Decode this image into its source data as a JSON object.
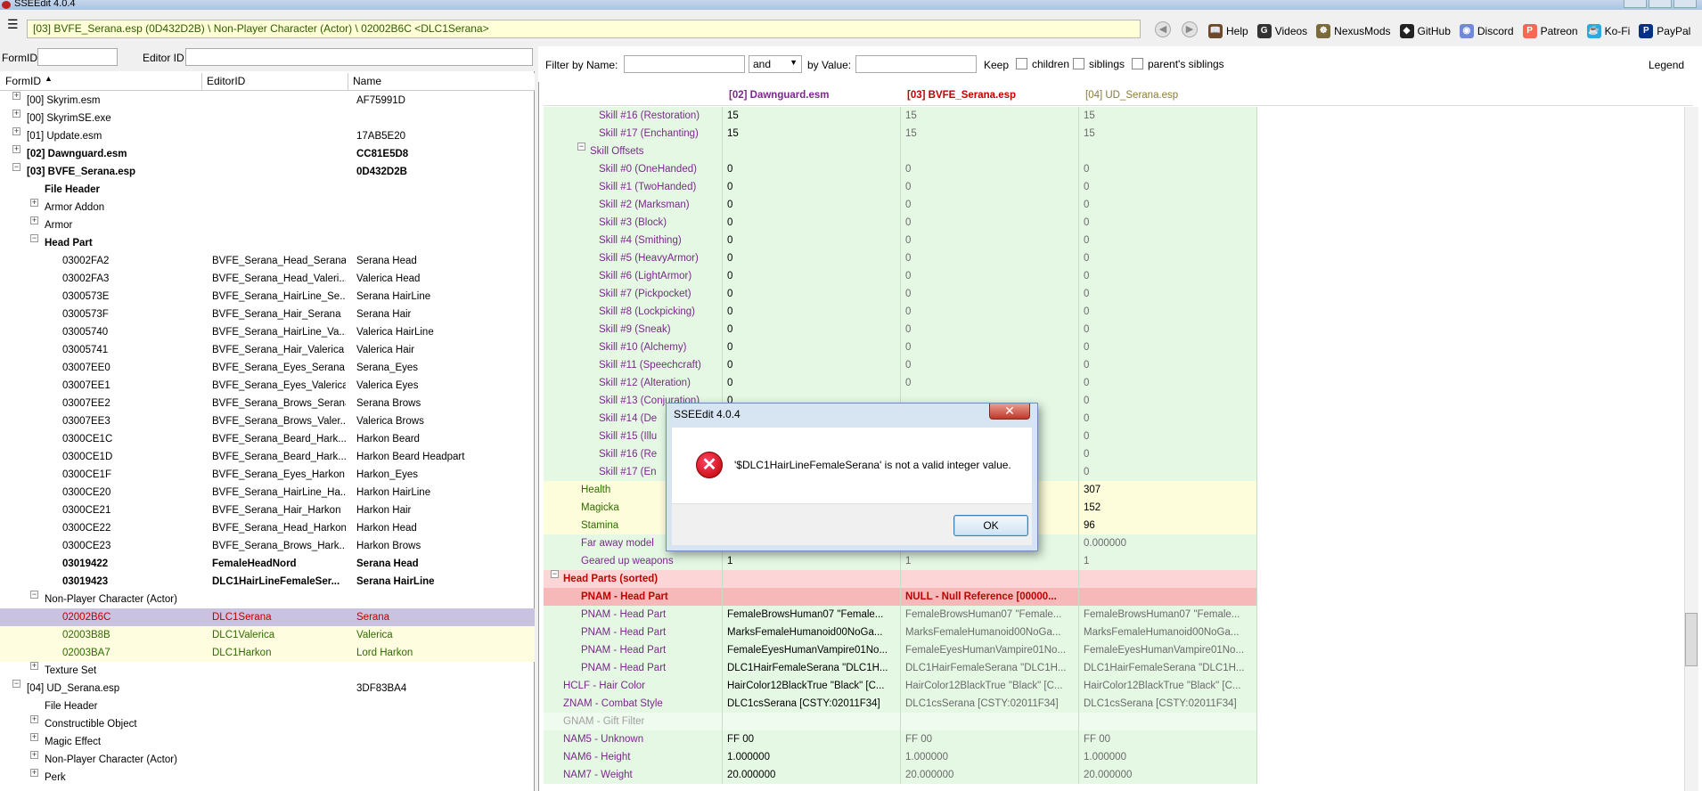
{
  "window": {
    "title": "SSEEdit 4.0.4"
  },
  "header": {
    "menu_glyph": "☰",
    "breadcrumb": "[03] BVFE_Serana.esp (0D432D2B) \\ Non-Player Character (Actor) \\ 02002B6C <DLC1Serana>",
    "back_glyph": "◀",
    "forward_glyph": "▶",
    "toolbar": [
      {
        "label": "Help",
        "icon": "book-icon",
        "color": "#6b4a2a",
        "glyph": "📖"
      },
      {
        "label": "Videos",
        "icon": "videos-icon",
        "color": "#333333",
        "glyph": "G"
      },
      {
        "label": "NexusMods",
        "icon": "nexusmods-icon",
        "color": "#7a6a3a",
        "glyph": "☸"
      },
      {
        "label": "GitHub",
        "icon": "github-icon",
        "color": "#222222",
        "glyph": "◆"
      },
      {
        "label": "Discord",
        "icon": "discord-icon",
        "color": "#7289da",
        "glyph": "◉"
      },
      {
        "label": "Patreon",
        "icon": "patreon-icon",
        "color": "#f96854",
        "glyph": "P"
      },
      {
        "label": "Ko-Fi",
        "icon": "kofi-icon",
        "color": "#29abe0",
        "glyph": "☕"
      },
      {
        "label": "PayPal",
        "icon": "paypal-icon",
        "color": "#003087",
        "glyph": "P"
      }
    ]
  },
  "left": {
    "formid_label": "FormID",
    "editorid_label": "Editor ID",
    "columns": [
      "FormID",
      "EditorID",
      "Name"
    ],
    "rows": [
      {
        "indent": 0,
        "exp": "+",
        "c1": "[00] Skyrim.esm",
        "c2": "",
        "c3": "AF75991D",
        "bold": false,
        "style": ""
      },
      {
        "indent": 0,
        "exp": "+",
        "c1": "[00] SkyrimSE.exe",
        "c2": "",
        "c3": "",
        "bold": false,
        "style": ""
      },
      {
        "indent": 0,
        "exp": "+",
        "c1": "[01] Update.esm",
        "c2": "",
        "c3": "17AB5E20",
        "bold": false,
        "style": ""
      },
      {
        "indent": 0,
        "exp": "+",
        "c1": "[02] Dawnguard.esm",
        "c2": "",
        "c3": "CC81E5D8",
        "bold": true,
        "style": ""
      },
      {
        "indent": 0,
        "exp": "−",
        "c1": "[03] BVFE_Serana.esp",
        "c2": "",
        "c3": "0D432D2B",
        "bold": true,
        "style": ""
      },
      {
        "indent": 1,
        "exp": "",
        "c1": "File Header",
        "c2": "",
        "c3": "",
        "bold": true,
        "style": ""
      },
      {
        "indent": 1,
        "exp": "+",
        "c1": "Armor Addon",
        "c2": "",
        "c3": "",
        "bold": false,
        "style": ""
      },
      {
        "indent": 1,
        "exp": "+",
        "c1": "Armor",
        "c2": "",
        "c3": "",
        "bold": false,
        "style": ""
      },
      {
        "indent": 1,
        "exp": "−",
        "c1": "Head Part",
        "c2": "",
        "c3": "",
        "bold": true,
        "style": ""
      },
      {
        "indent": 2,
        "exp": "",
        "c1": "03002FA2",
        "c2": "BVFE_Serana_Head_Serana",
        "c3": "Serana Head",
        "bold": false,
        "style": ""
      },
      {
        "indent": 2,
        "exp": "",
        "c1": "03002FA3",
        "c2": "BVFE_Serana_Head_Valeri...",
        "c3": "Valerica Head",
        "bold": false,
        "style": ""
      },
      {
        "indent": 2,
        "exp": "",
        "c1": "0300573E",
        "c2": "BVFE_Serana_HairLine_Se...",
        "c3": "Serana HairLine",
        "bold": false,
        "style": ""
      },
      {
        "indent": 2,
        "exp": "",
        "c1": "0300573F",
        "c2": "BVFE_Serana_Hair_Serana",
        "c3": "Serana Hair",
        "bold": false,
        "style": ""
      },
      {
        "indent": 2,
        "exp": "",
        "c1": "03005740",
        "c2": "BVFE_Serana_HairLine_Va...",
        "c3": "Valerica HairLine",
        "bold": false,
        "style": ""
      },
      {
        "indent": 2,
        "exp": "",
        "c1": "03005741",
        "c2": "BVFE_Serana_Hair_Valerica",
        "c3": "Valerica Hair",
        "bold": false,
        "style": ""
      },
      {
        "indent": 2,
        "exp": "",
        "c1": "03007EE0",
        "c2": "BVFE_Serana_Eyes_Serana",
        "c3": "Serana_Eyes",
        "bold": false,
        "style": ""
      },
      {
        "indent": 2,
        "exp": "",
        "c1": "03007EE1",
        "c2": "BVFE_Serana_Eyes_Valerica",
        "c3": "Valerica Eyes",
        "bold": false,
        "style": ""
      },
      {
        "indent": 2,
        "exp": "",
        "c1": "03007EE2",
        "c2": "BVFE_Serana_Brows_Serana",
        "c3": "Serana Brows",
        "bold": false,
        "style": ""
      },
      {
        "indent": 2,
        "exp": "",
        "c1": "03007EE3",
        "c2": "BVFE_Serana_Brows_Valer...",
        "c3": "Valerica Brows",
        "bold": false,
        "style": ""
      },
      {
        "indent": 2,
        "exp": "",
        "c1": "0300CE1C",
        "c2": "BVFE_Serana_Beard_Hark...",
        "c3": "Harkon Beard",
        "bold": false,
        "style": ""
      },
      {
        "indent": 2,
        "exp": "",
        "c1": "0300CE1D",
        "c2": "BVFE_Serana_Beard_Hark...",
        "c3": "Harkon Beard Headpart",
        "bold": false,
        "style": ""
      },
      {
        "indent": 2,
        "exp": "",
        "c1": "0300CE1F",
        "c2": "BVFE_Serana_Eyes_Harkon",
        "c3": "Harkon_Eyes",
        "bold": false,
        "style": ""
      },
      {
        "indent": 2,
        "exp": "",
        "c1": "0300CE20",
        "c2": "BVFE_Serana_HairLine_Ha...",
        "c3": "Harkon HairLine",
        "bold": false,
        "style": ""
      },
      {
        "indent": 2,
        "exp": "",
        "c1": "0300CE21",
        "c2": "BVFE_Serana_Hair_Harkon",
        "c3": "Harkon Hair",
        "bold": false,
        "style": ""
      },
      {
        "indent": 2,
        "exp": "",
        "c1": "0300CE22",
        "c2": "BVFE_Serana_Head_Harkon",
        "c3": "Harkon Head",
        "bold": false,
        "style": ""
      },
      {
        "indent": 2,
        "exp": "",
        "c1": "0300CE23",
        "c2": "BVFE_Serana_Brows_Hark...",
        "c3": "Harkon Brows",
        "bold": false,
        "style": ""
      },
      {
        "indent": 2,
        "exp": "",
        "c1": "03019422",
        "c2": "FemaleHeadNord",
        "c3": "Serana Head",
        "bold": true,
        "style": ""
      },
      {
        "indent": 2,
        "exp": "",
        "c1": "03019423",
        "c2": "DLC1HairLineFemaleSer...",
        "c3": "Serana HairLine",
        "bold": true,
        "style": ""
      },
      {
        "indent": 1,
        "exp": "−",
        "c1": "Non-Player Character (Actor)",
        "c2": "",
        "c3": "",
        "bold": false,
        "style": ""
      },
      {
        "indent": 2,
        "exp": "",
        "c1": "02002B6C",
        "c2": "DLC1Serana",
        "c3": "Serana",
        "bold": false,
        "style": "sel"
      },
      {
        "indent": 2,
        "exp": "",
        "c1": "02003B8B",
        "c2": "DLC1Valerica",
        "c3": "Valerica",
        "bold": false,
        "style": "yel"
      },
      {
        "indent": 2,
        "exp": "",
        "c1": "02003BA7",
        "c2": "DLC1Harkon",
        "c3": "Lord Harkon",
        "bold": false,
        "style": "yel"
      },
      {
        "indent": 1,
        "exp": "+",
        "c1": "Texture Set",
        "c2": "",
        "c3": "",
        "bold": false,
        "style": ""
      },
      {
        "indent": 0,
        "exp": "−",
        "c1": "[04] UD_Serana.esp",
        "c2": "",
        "c3": "3DF83BA4",
        "bold": false,
        "style": ""
      },
      {
        "indent": 1,
        "exp": "",
        "c1": "File Header",
        "c2": "",
        "c3": "",
        "bold": false,
        "style": ""
      },
      {
        "indent": 1,
        "exp": "+",
        "c1": "Constructible Object",
        "c2": "",
        "c3": "",
        "bold": false,
        "style": ""
      },
      {
        "indent": 1,
        "exp": "+",
        "c1": "Magic Effect",
        "c2": "",
        "c3": "",
        "bold": false,
        "style": ""
      },
      {
        "indent": 1,
        "exp": "+",
        "c1": "Non-Player Character (Actor)",
        "c2": "",
        "c3": "",
        "bold": false,
        "style": ""
      },
      {
        "indent": 1,
        "exp": "+",
        "c1": "Perk",
        "c2": "",
        "c3": "",
        "bold": false,
        "style": ""
      }
    ]
  },
  "right": {
    "filter_by_name_label": "Filter by Name:",
    "and_value": "and",
    "by_value_label": "by Value:",
    "keep_label": "Keep",
    "children_label": "children",
    "siblings_label": "siblings",
    "parents_siblings_label": "parent's siblings",
    "legend_label": "Legend",
    "columns": [
      "[02] Dawnguard.esm",
      "[03] BVFE_Serana.esp",
      "[04] UD_Serana.esp"
    ],
    "rows": [
      {
        "indent": 4,
        "exp": "",
        "label": "Skill #16 (Restoration)",
        "v": [
          "15",
          "15",
          "15"
        ],
        "bg": "green"
      },
      {
        "indent": 4,
        "exp": "",
        "label": "Skill #17 (Enchanting)",
        "v": [
          "15",
          "15",
          "15"
        ],
        "bg": "green"
      },
      {
        "indent": 3,
        "exp": "−",
        "label": "Skill Offsets",
        "v": [
          "",
          "",
          ""
        ],
        "bg": "green"
      },
      {
        "indent": 4,
        "exp": "",
        "label": "Skill #0 (OneHanded)",
        "v": [
          "0",
          "0",
          "0"
        ],
        "bg": "green"
      },
      {
        "indent": 4,
        "exp": "",
        "label": "Skill #1 (TwoHanded)",
        "v": [
          "0",
          "0",
          "0"
        ],
        "bg": "green"
      },
      {
        "indent": 4,
        "exp": "",
        "label": "Skill #2 (Marksman)",
        "v": [
          "0",
          "0",
          "0"
        ],
        "bg": "green"
      },
      {
        "indent": 4,
        "exp": "",
        "label": "Skill #3 (Block)",
        "v": [
          "0",
          "0",
          "0"
        ],
        "bg": "green"
      },
      {
        "indent": 4,
        "exp": "",
        "label": "Skill #4 (Smithing)",
        "v": [
          "0",
          "0",
          "0"
        ],
        "bg": "green"
      },
      {
        "indent": 4,
        "exp": "",
        "label": "Skill #5 (HeavyArmor)",
        "v": [
          "0",
          "0",
          "0"
        ],
        "bg": "green"
      },
      {
        "indent": 4,
        "exp": "",
        "label": "Skill #6 (LightArmor)",
        "v": [
          "0",
          "0",
          "0"
        ],
        "bg": "green"
      },
      {
        "indent": 4,
        "exp": "",
        "label": "Skill #7 (Pickpocket)",
        "v": [
          "0",
          "0",
          "0"
        ],
        "bg": "green"
      },
      {
        "indent": 4,
        "exp": "",
        "label": "Skill #8 (Lockpicking)",
        "v": [
          "0",
          "0",
          "0"
        ],
        "bg": "green"
      },
      {
        "indent": 4,
        "exp": "",
        "label": "Skill #9 (Sneak)",
        "v": [
          "0",
          "0",
          "0"
        ],
        "bg": "green"
      },
      {
        "indent": 4,
        "exp": "",
        "label": "Skill #10 (Alchemy)",
        "v": [
          "0",
          "0",
          "0"
        ],
        "bg": "green"
      },
      {
        "indent": 4,
        "exp": "",
        "label": "Skill #11 (Speechcraft)",
        "v": [
          "0",
          "0",
          "0"
        ],
        "bg": "green"
      },
      {
        "indent": 4,
        "exp": "",
        "label": "Skill #12 (Alteration)",
        "v": [
          "0",
          "0",
          "0"
        ],
        "bg": "green"
      },
      {
        "indent": 4,
        "exp": "",
        "label": "Skill #13 (Conjuration)",
        "v": [
          "0",
          "",
          "0"
        ],
        "bg": "green"
      },
      {
        "indent": 4,
        "exp": "",
        "label": "Skill #14 (De",
        "v": [
          "",
          "",
          "0"
        ],
        "bg": "green"
      },
      {
        "indent": 4,
        "exp": "",
        "label": "Skill #15 (Illu",
        "v": [
          "",
          "",
          "0"
        ],
        "bg": "green"
      },
      {
        "indent": 4,
        "exp": "",
        "label": "Skill #16 (Re",
        "v": [
          "",
          "",
          "0"
        ],
        "bg": "green"
      },
      {
        "indent": 4,
        "exp": "",
        "label": "Skill #17 (En",
        "v": [
          "",
          "",
          "0"
        ],
        "bg": "green"
      },
      {
        "indent": 2,
        "exp": "",
        "label": "Health",
        "v": [
          "",
          "",
          "307"
        ],
        "bg": "yellow"
      },
      {
        "indent": 2,
        "exp": "",
        "label": "Magicka",
        "v": [
          "",
          "",
          "152"
        ],
        "bg": "yellow"
      },
      {
        "indent": 2,
        "exp": "",
        "label": "Stamina",
        "v": [
          "",
          "",
          "96"
        ],
        "bg": "yellow"
      },
      {
        "indent": 2,
        "exp": "",
        "label": "Far away model",
        "v": [
          "",
          "",
          "0.000000"
        ],
        "bg": "green"
      },
      {
        "indent": 2,
        "exp": "",
        "label": "Geared up weapons",
        "v": [
          "1",
          "1",
          "1"
        ],
        "bg": "green"
      },
      {
        "indent": 0,
        "exp": "−",
        "label": "Head Parts (sorted)",
        "v": [
          "",
          "",
          ""
        ],
        "bg": "red"
      },
      {
        "indent": 2,
        "exp": "",
        "label": "PNAM - Head Part",
        "v": [
          "",
          "NULL - Null Reference [00000...",
          ""
        ],
        "bg": "redsel"
      },
      {
        "indent": 2,
        "exp": "",
        "label": "PNAM - Head Part",
        "v": [
          "FemaleBrowsHuman07 \"Female...",
          "FemaleBrowsHuman07 \"Female...",
          "FemaleBrowsHuman07 \"Female..."
        ],
        "bg": "green"
      },
      {
        "indent": 2,
        "exp": "",
        "label": "PNAM - Head Part",
        "v": [
          "MarksFemaleHumanoid00NoGa...",
          "MarksFemaleHumanoid00NoGa...",
          "MarksFemaleHumanoid00NoGa..."
        ],
        "bg": "green"
      },
      {
        "indent": 2,
        "exp": "",
        "label": "PNAM - Head Part",
        "v": [
          "FemaleEyesHumanVampire01No...",
          "FemaleEyesHumanVampire01No...",
          "FemaleEyesHumanVampire01No..."
        ],
        "bg": "green"
      },
      {
        "indent": 2,
        "exp": "",
        "label": "PNAM - Head Part",
        "v": [
          "DLC1HairFemaleSerana \"DLC1H...",
          "DLC1HairFemaleSerana \"DLC1H...",
          "DLC1HairFemaleSerana \"DLC1H..."
        ],
        "bg": "green"
      },
      {
        "indent": 0,
        "exp": "",
        "label": "HCLF - Hair Color",
        "v": [
          "HairColor12BlackTrue \"Black\" [C...",
          "HairColor12BlackTrue \"Black\" [C...",
          "HairColor12BlackTrue \"Black\" [C..."
        ],
        "bg": "green"
      },
      {
        "indent": 0,
        "exp": "",
        "label": "ZNAM - Combat Style",
        "v": [
          "DLC1csSerana [CSTY:02011F34]",
          "DLC1csSerana [CSTY:02011F34]",
          "DLC1csSerana [CSTY:02011F34]"
        ],
        "bg": "green"
      },
      {
        "indent": 0,
        "exp": "",
        "label": "GNAM - Gift Filter",
        "v": [
          "",
          "",
          ""
        ],
        "bg": "greenlight"
      },
      {
        "indent": 0,
        "exp": "",
        "label": "NAM5 - Unknown",
        "v": [
          "FF 00",
          "FF 00",
          "FF 00"
        ],
        "bg": "green"
      },
      {
        "indent": 0,
        "exp": "",
        "label": "NAM6 - Height",
        "v": [
          "1.000000",
          "1.000000",
          "1.000000"
        ],
        "bg": "green"
      },
      {
        "indent": 0,
        "exp": "",
        "label": "NAM7 - Weight",
        "v": [
          "20.000000",
          "20.000000",
          "20.000000"
        ],
        "bg": "green"
      }
    ]
  },
  "dialog": {
    "title": "SSEEdit 4.0.4",
    "close_glyph": "✕",
    "error_glyph": "✕",
    "message": "'$DLC1HairLineFemaleSerana' is not a valid integer value.",
    "ok_label": "OK"
  },
  "colors": {
    "row_green": "#e4f8e4",
    "row_green_light": "#eefbee",
    "row_yellow": "#fdfddb",
    "row_red": "#fcd6d6",
    "row_red_sel": "#f6b8b8",
    "sel_left": "#c9c2e0",
    "yellow_left": "#fffde0",
    "label_purple": "#7a2a8a",
    "label_red": "#c00000",
    "text_green": "#2e6b00",
    "header_col3": "#8a7a3a"
  }
}
